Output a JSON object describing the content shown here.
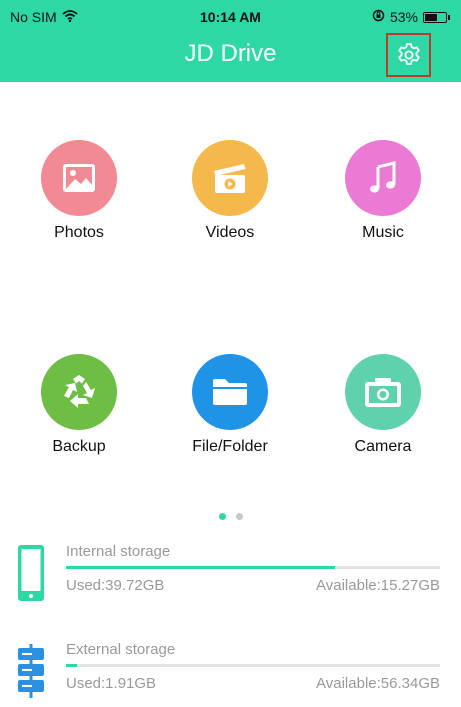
{
  "status_bar": {
    "carrier": "No SIM",
    "time": "10:14 AM",
    "battery": "53%",
    "battery_level": 0.53
  },
  "header": {
    "title": "JD Drive",
    "accent_color": "#2dd8a4"
  },
  "tiles": [
    {
      "label": "Photos",
      "icon": "photo-icon",
      "color": "#f28a93"
    },
    {
      "label": "Videos",
      "icon": "video-clapper-icon",
      "color": "#f5b84c"
    },
    {
      "label": "Music",
      "icon": "music-note-icon",
      "color": "#ea7ad4"
    },
    {
      "label": "Backup",
      "icon": "recycle-icon",
      "color": "#6ebd45"
    },
    {
      "label": "File/Folder",
      "icon": "folder-icon",
      "color": "#1f93e6"
    },
    {
      "label": "Camera",
      "icon": "camera-icon",
      "color": "#5fd2ad"
    }
  ],
  "pager": {
    "page_count": 2,
    "active_index": 0,
    "active_color": "#2dd8a4",
    "inactive_color": "#c8c8c8"
  },
  "storage": {
    "internal": {
      "name": "Internal storage",
      "used": "Used:39.72GB",
      "available": "Available:15.27GB",
      "used_fraction": 0.72,
      "icon": "phone-icon"
    },
    "external": {
      "name": "External storage",
      "used": "Used:1.91GB",
      "available": "Available:56.34GB",
      "used_fraction": 0.03,
      "icon": "external-drive-icon"
    }
  }
}
